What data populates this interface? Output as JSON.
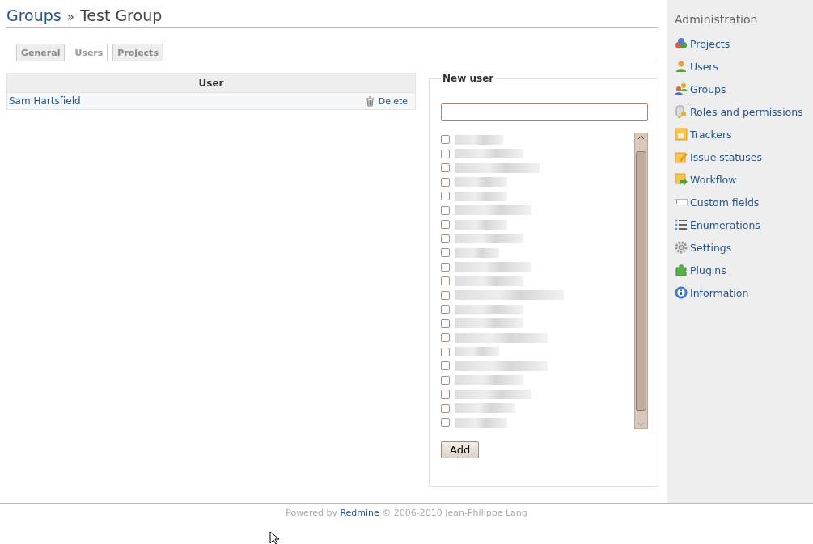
{
  "heading": {
    "parent": "Groups",
    "separator": "»",
    "current": "Test Group"
  },
  "tabs": [
    {
      "label": "General",
      "selected": false
    },
    {
      "label": "Users",
      "selected": true
    },
    {
      "label": "Projects",
      "selected": false
    }
  ],
  "users_table": {
    "columns": [
      "User"
    ],
    "rows": [
      {
        "name": "Sam Hartsfield",
        "action": "Delete"
      }
    ]
  },
  "new_user": {
    "legend": "New user",
    "candidates": [
      {
        "checked": false
      },
      {
        "checked": false
      },
      {
        "checked": false
      },
      {
        "checked": false
      },
      {
        "checked": false
      },
      {
        "checked": false
      },
      {
        "checked": false
      },
      {
        "checked": false
      },
      {
        "checked": false
      },
      {
        "checked": false
      },
      {
        "checked": false
      },
      {
        "checked": false
      },
      {
        "checked": false
      },
      {
        "checked": false
      },
      {
        "checked": false
      },
      {
        "checked": false
      },
      {
        "checked": false
      },
      {
        "checked": false
      },
      {
        "checked": false
      },
      {
        "checked": false
      },
      {
        "checked": false
      }
    ],
    "button": "Add"
  },
  "sidebar": {
    "title": "Administration",
    "items": [
      {
        "label": "Projects",
        "kind": "projects"
      },
      {
        "label": "Users",
        "kind": "user"
      },
      {
        "label": "Groups",
        "kind": "group"
      },
      {
        "label": "Roles and permissions",
        "kind": "roles"
      },
      {
        "label": "Trackers",
        "kind": "tracker"
      },
      {
        "label": "Issue statuses",
        "kind": "status"
      },
      {
        "label": "Workflow",
        "kind": "workflow"
      },
      {
        "label": "Custom fields",
        "kind": "field"
      },
      {
        "label": "Enumerations",
        "kind": "list"
      },
      {
        "label": "Settings",
        "kind": "gear"
      },
      {
        "label": "Plugins",
        "kind": "plugin"
      },
      {
        "label": "Information",
        "kind": "info"
      }
    ]
  },
  "footer": {
    "prefix": "Powered by",
    "link": "Redmine",
    "suffix": "© 2006-2010 Jean-Philippe Lang"
  }
}
